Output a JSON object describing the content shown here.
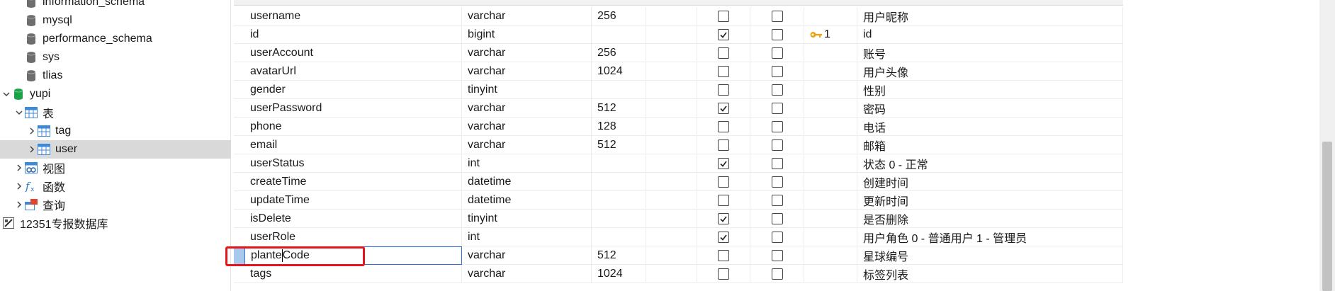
{
  "tree": {
    "items": [
      {
        "label": "information_schema",
        "kind": "database",
        "indent": 1,
        "chevron": ""
      },
      {
        "label": "mysql",
        "kind": "database",
        "indent": 1,
        "chevron": ""
      },
      {
        "label": "performance_schema",
        "kind": "database",
        "indent": 1,
        "chevron": ""
      },
      {
        "label": "sys",
        "kind": "database",
        "indent": 1,
        "chevron": ""
      },
      {
        "label": "tlias",
        "kind": "database",
        "indent": 1,
        "chevron": ""
      },
      {
        "label": "yupi",
        "kind": "database-open",
        "indent": 0,
        "chevron": "down"
      },
      {
        "label": "表",
        "kind": "tables",
        "indent": 1,
        "chevron": "down"
      },
      {
        "label": "tag",
        "kind": "table",
        "indent": 2,
        "chevron": "right"
      },
      {
        "label": "user",
        "kind": "table",
        "indent": 2,
        "chevron": "right",
        "selected": true
      },
      {
        "label": "视图",
        "kind": "views",
        "indent": 1,
        "chevron": "right"
      },
      {
        "label": "函数",
        "kind": "functions",
        "indent": 1,
        "chevron": "right"
      },
      {
        "label": "查询",
        "kind": "queries",
        "indent": 1,
        "chevron": "right"
      },
      {
        "label": "12351专报数据库",
        "kind": "connection",
        "indent": -1,
        "chevron": ""
      }
    ]
  },
  "fields": {
    "rows": [
      {
        "name": "username",
        "type": "varchar",
        "length": "256",
        "not_null": false,
        "virtual": false,
        "key": "",
        "comment": "用户昵称"
      },
      {
        "name": "id",
        "type": "bigint",
        "length": "",
        "not_null": true,
        "virtual": false,
        "key": "1",
        "comment": "id"
      },
      {
        "name": "userAccount",
        "type": "varchar",
        "length": "256",
        "not_null": false,
        "virtual": false,
        "key": "",
        "comment": "账号"
      },
      {
        "name": "avatarUrl",
        "type": "varchar",
        "length": "1024",
        "not_null": false,
        "virtual": false,
        "key": "",
        "comment": "用户头像"
      },
      {
        "name": "gender",
        "type": "tinyint",
        "length": "",
        "not_null": false,
        "virtual": false,
        "key": "",
        "comment": "性别"
      },
      {
        "name": "userPassword",
        "type": "varchar",
        "length": "512",
        "not_null": true,
        "virtual": false,
        "key": "",
        "comment": "密码"
      },
      {
        "name": "phone",
        "type": "varchar",
        "length": "128",
        "not_null": false,
        "virtual": false,
        "key": "",
        "comment": "电话"
      },
      {
        "name": "email",
        "type": "varchar",
        "length": "512",
        "not_null": false,
        "virtual": false,
        "key": "",
        "comment": "邮箱"
      },
      {
        "name": "userStatus",
        "type": "int",
        "length": "",
        "not_null": true,
        "virtual": false,
        "key": "",
        "comment": "状态 0 - 正常"
      },
      {
        "name": "createTime",
        "type": "datetime",
        "length": "",
        "not_null": false,
        "virtual": false,
        "key": "",
        "comment": "创建时间"
      },
      {
        "name": "updateTime",
        "type": "datetime",
        "length": "",
        "not_null": false,
        "virtual": false,
        "key": "",
        "comment": "更新时间"
      },
      {
        "name": "isDelete",
        "type": "tinyint",
        "length": "",
        "not_null": true,
        "virtual": false,
        "key": "",
        "comment": "是否删除"
      },
      {
        "name": "userRole",
        "type": "int",
        "length": "",
        "not_null": true,
        "virtual": false,
        "key": "",
        "comment": "用户角色 0 - 普通用户 1 - 管理员"
      },
      {
        "name": "planteCode",
        "type": "varchar",
        "length": "512",
        "not_null": false,
        "virtual": false,
        "key": "",
        "comment": "星球编号",
        "editing": true,
        "caret_after": "plante"
      },
      {
        "name": "tags",
        "type": "varchar",
        "length": "1024",
        "not_null": false,
        "virtual": false,
        "key": "",
        "comment": "标签列表"
      }
    ]
  },
  "colors": {
    "highlight": "#e4161b",
    "edit_border": "#2f6fce",
    "selected_row": "#d9d9d9",
    "row_marker": "#a9c8ee",
    "db_icon_gray": "#6d6d6d",
    "db_icon_green": "#1aa34a",
    "key_icon": "#e8a317"
  },
  "icons": {
    "database": "database-icon",
    "table": "table-icon",
    "view": "view-icon",
    "function": "function-icon",
    "query": "query-icon",
    "connection": "connection-icon",
    "key": "key-icon",
    "check": "check-icon"
  }
}
